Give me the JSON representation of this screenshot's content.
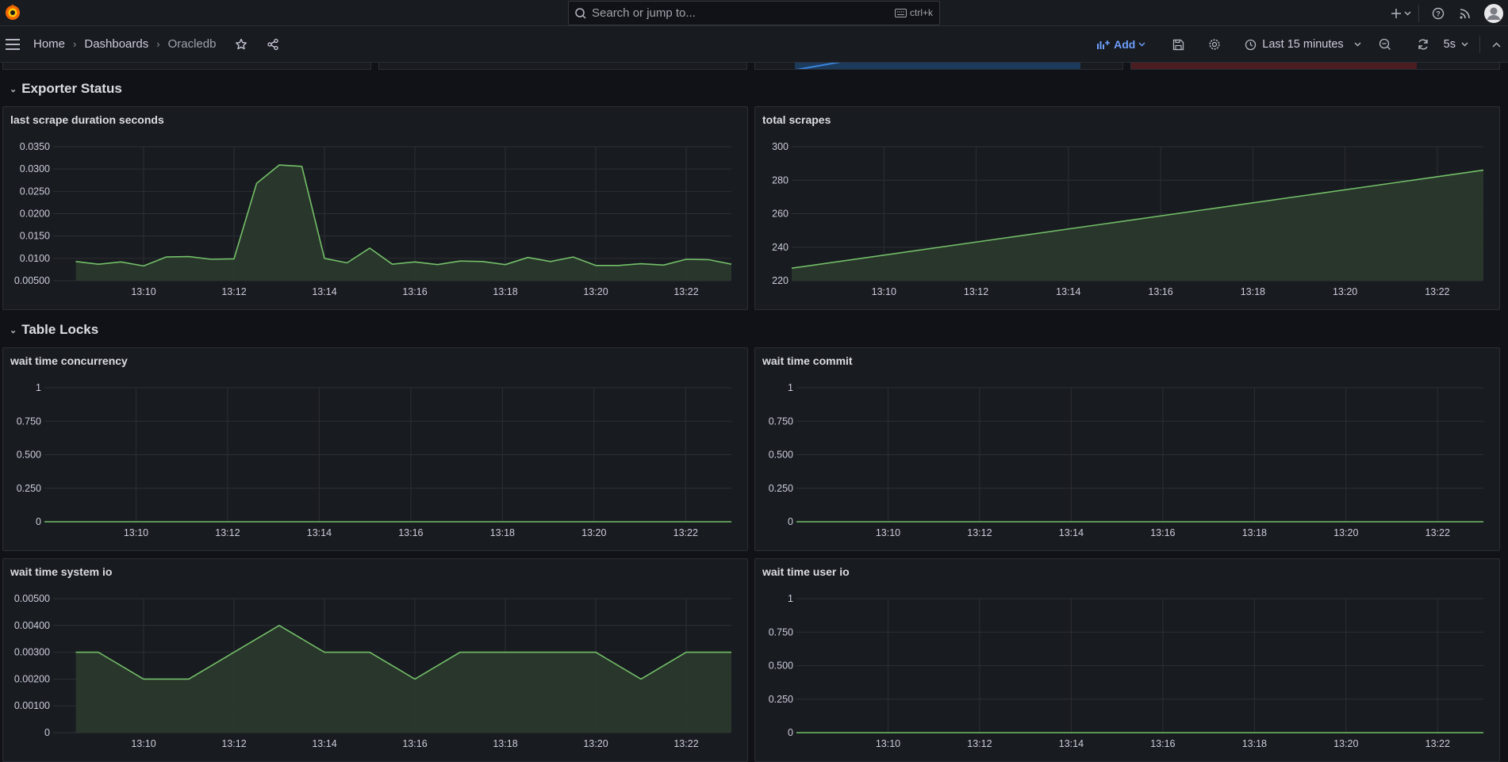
{
  "app": {
    "logo_name": "grafana"
  },
  "search": {
    "placeholder": "Search or jump to...",
    "shortcut": "ctrl+k"
  },
  "breadcrumb": {
    "home": "Home",
    "dashboards": "Dashboards",
    "current": "Oracledb"
  },
  "toolbar": {
    "add_label": "Add",
    "time_range": "Last 15 minutes",
    "refresh_interval": "5s"
  },
  "rows": [
    {
      "title": "Exporter Status"
    },
    {
      "title": "Table Locks"
    }
  ],
  "panels": {
    "last_scrape": {
      "title": "last scrape duration seconds"
    },
    "total_scrapes": {
      "title": "total scrapes"
    },
    "wait_concurrency": {
      "title": "wait time concurrency"
    },
    "wait_commit": {
      "title": "wait time commit"
    },
    "wait_system_io": {
      "title": "wait time system io"
    },
    "wait_user_io": {
      "title": "wait time user io"
    }
  },
  "colors": {
    "series": "#73bf69",
    "fill": "#2b3a2c",
    "grid": "#2c2f35",
    "bg": "#181b1f"
  },
  "chart_data": [
    {
      "id": "last_scrape",
      "type": "area",
      "title": "last scrape duration seconds",
      "x": [
        "13:08:30",
        "13:09",
        "13:09:30",
        "13:10",
        "13:10:30",
        "13:11",
        "13:11:30",
        "13:12",
        "13:12:30",
        "13:13",
        "13:13:30",
        "13:14",
        "13:14:30",
        "13:15",
        "13:15:30",
        "13:16",
        "13:16:30",
        "13:17",
        "13:17:30",
        "13:18",
        "13:18:30",
        "13:19",
        "13:19:30",
        "13:20",
        "13:20:30",
        "13:21",
        "13:21:30",
        "13:22",
        "13:22:30",
        "13:23"
      ],
      "values": [
        0.0093,
        0.0087,
        0.0092,
        0.0083,
        0.0103,
        0.0104,
        0.0098,
        0.0099,
        0.0268,
        0.0309,
        0.0306,
        0.01,
        0.009,
        0.0123,
        0.0087,
        0.0092,
        0.0086,
        0.0094,
        0.0093,
        0.0086,
        0.0102,
        0.0093,
        0.0103,
        0.0084,
        0.0084,
        0.0088,
        0.0085,
        0.0098,
        0.0097,
        0.0087
      ],
      "x_ticks": [
        "13:10",
        "13:12",
        "13:14",
        "13:16",
        "13:18",
        "13:20",
        "13:22"
      ],
      "y_ticks": [
        "0.0350",
        "0.0300",
        "0.0250",
        "0.0200",
        "0.0150",
        "0.0100",
        "0.00500"
      ],
      "ylim": [
        0.005,
        0.035
      ]
    },
    {
      "id": "total_scrapes",
      "type": "area",
      "title": "total scrapes",
      "x": [
        "13:08:00",
        "13:23:00"
      ],
      "values": [
        227.5,
        286
      ],
      "x_ticks": [
        "13:10",
        "13:12",
        "13:14",
        "13:16",
        "13:18",
        "13:20",
        "13:22"
      ],
      "y_ticks": [
        "300",
        "280",
        "260",
        "240",
        "220"
      ],
      "ylim": [
        220,
        300
      ]
    },
    {
      "id": "wait_concurrency",
      "type": "line",
      "title": "wait time concurrency",
      "x": [
        "13:08:00",
        "13:23:00"
      ],
      "values": [
        0,
        0
      ],
      "x_ticks": [
        "13:10",
        "13:12",
        "13:14",
        "13:16",
        "13:18",
        "13:20",
        "13:22"
      ],
      "y_ticks": [
        "1",
        "0.750",
        "0.500",
        "0.250",
        "0"
      ],
      "ylim": [
        0,
        1
      ]
    },
    {
      "id": "wait_commit",
      "type": "line",
      "title": "wait time commit",
      "x": [
        "13:08:00",
        "13:23:00"
      ],
      "values": [
        0,
        0
      ],
      "x_ticks": [
        "13:10",
        "13:12",
        "13:14",
        "13:16",
        "13:18",
        "13:20",
        "13:22"
      ],
      "y_ticks": [
        "1",
        "0.750",
        "0.500",
        "0.250",
        "0"
      ],
      "ylim": [
        0,
        1
      ]
    },
    {
      "id": "wait_system_io",
      "type": "area",
      "title": "wait time system io",
      "x": [
        "13:08:30",
        "13:09:00",
        "13:10:00",
        "13:11:00",
        "13:12:00",
        "13:13:00",
        "13:14:00",
        "13:15:00",
        "13:16:00",
        "13:17:00",
        "13:18:00",
        "13:19:00",
        "13:20:00",
        "13:21:00",
        "13:22:00",
        "13:23:00"
      ],
      "values": [
        0.003,
        0.003,
        0.002,
        0.002,
        0.003,
        0.004,
        0.003,
        0.003,
        0.002,
        0.003,
        0.003,
        0.003,
        0.003,
        0.002,
        0.003,
        0.003
      ],
      "x_ticks": [
        "13:10",
        "13:12",
        "13:14",
        "13:16",
        "13:18",
        "13:20",
        "13:22"
      ],
      "y_ticks": [
        "0.00500",
        "0.00400",
        "0.00300",
        "0.00200",
        "0.00100",
        "0"
      ],
      "ylim": [
        0,
        0.005
      ]
    },
    {
      "id": "wait_user_io",
      "type": "line",
      "title": "wait time user io",
      "x": [
        "13:08:00",
        "13:23:00"
      ],
      "values": [
        0,
        0
      ],
      "x_ticks": [
        "13:10",
        "13:12",
        "13:14",
        "13:16",
        "13:18",
        "13:20",
        "13:22"
      ],
      "y_ticks": [
        "1",
        "0.750",
        "0.500",
        "0.250",
        "0"
      ],
      "ylim": [
        0,
        1
      ]
    }
  ]
}
